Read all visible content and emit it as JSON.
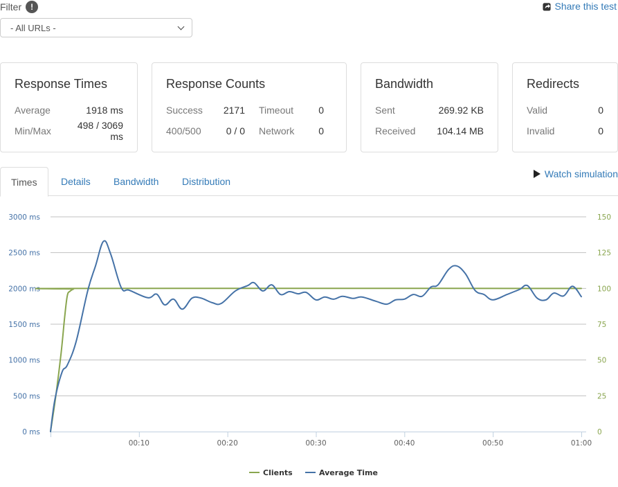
{
  "filter": {
    "label": "Filter",
    "info_icon": "exclamation-icon",
    "selected": "- All URLs -"
  },
  "share": {
    "label": "Share this test",
    "icon": "share-icon"
  },
  "cards": {
    "response_times": {
      "title": "Response Times",
      "average_label": "Average",
      "average_value": "1918 ms",
      "minmax_label": "Min/Max",
      "minmax_value": "498 / 3069 ms"
    },
    "response_counts": {
      "title": "Response Counts",
      "success_label": "Success",
      "success_value": "2171",
      "timeout_label": "Timeout",
      "timeout_value": "0",
      "errors_label": "400/500",
      "errors_value": "0 / 0",
      "network_label": "Network",
      "network_value": "0"
    },
    "bandwidth": {
      "title": "Bandwidth",
      "sent_label": "Sent",
      "sent_value": "269.92 KB",
      "received_label": "Received",
      "received_value": "104.14 MB"
    },
    "redirects": {
      "title": "Redirects",
      "valid_label": "Valid",
      "valid_value": "0",
      "invalid_label": "Invalid",
      "invalid_value": "0"
    }
  },
  "tabs": [
    {
      "label": "Times",
      "active": true
    },
    {
      "label": "Details",
      "active": false
    },
    {
      "label": "Bandwidth",
      "active": false
    },
    {
      "label": "Distribution",
      "active": false
    }
  ],
  "watch_simulation": {
    "label": "Watch simulation",
    "icon": "play-icon"
  },
  "colors": {
    "clients": "#89a54e",
    "average_time": "#4572a7",
    "link": "#337ab7"
  },
  "chart_data": {
    "type": "line",
    "title": "",
    "xlabel": "",
    "ylabel": "",
    "x_unit": "seconds",
    "x_ticks": [
      {
        "value": 10,
        "label": "00:10"
      },
      {
        "value": 20,
        "label": "00:20"
      },
      {
        "value": 30,
        "label": "00:30"
      },
      {
        "value": 40,
        "label": "00:40"
      },
      {
        "value": 50,
        "label": "00:50"
      },
      {
        "value": 60,
        "label": "01:00"
      }
    ],
    "xlim": [
      0,
      60
    ],
    "y_left": {
      "range": [
        0,
        3000
      ],
      "ticks": [
        {
          "value": 0,
          "label": "0 ms"
        },
        {
          "value": 500,
          "label": "500 ms"
        },
        {
          "value": 1000,
          "label": "1000 ms"
        },
        {
          "value": 1500,
          "label": "1500 ms"
        },
        {
          "value": 2000,
          "label": "2000 ms"
        },
        {
          "value": 2500,
          "label": "2500 ms"
        },
        {
          "value": 3000,
          "label": "3000 ms"
        }
      ]
    },
    "y_right": {
      "range": [
        0,
        150
      ],
      "ticks": [
        {
          "value": 0,
          "label": "0"
        },
        {
          "value": 25,
          "label": "25"
        },
        {
          "value": 50,
          "label": "50"
        },
        {
          "value": 75,
          "label": "75"
        },
        {
          "value": 100,
          "label": "100"
        },
        {
          "value": 125,
          "label": "125"
        },
        {
          "value": 150,
          "label": "150"
        }
      ]
    },
    "grid": true,
    "legend": "bottom-center",
    "series": [
      {
        "name": "Clients",
        "axis": "right",
        "color": "#89a54e",
        "x": [
          0,
          0.6,
          1.2,
          1.6,
          1.9,
          2.2,
          2.6,
          3,
          60
        ],
        "y": [
          0,
          25,
          55,
          80,
          95,
          98,
          99.5,
          100,
          100
        ]
      },
      {
        "name": "Average Time",
        "axis": "left",
        "color": "#4572a7",
        "x": [
          0,
          0.5,
          1.3,
          1.9,
          2.9,
          4.2,
          5.1,
          6,
          6.8,
          8,
          8.9,
          11,
          12,
          12.9,
          13.9,
          14.9,
          16,
          17,
          18.3,
          19.3,
          20.9,
          22.3,
          23,
          24,
          25,
          26,
          27,
          28,
          28.9,
          30,
          31,
          32,
          33,
          34.2,
          35.2,
          36.8,
          38,
          39,
          40,
          41,
          42,
          43,
          43.8,
          45,
          45.9,
          46.9,
          48,
          49,
          50,
          51.6,
          53,
          53.9,
          55,
          56,
          56.9,
          58,
          59,
          60
        ],
        "y": [
          0,
          450,
          830,
          930,
          1260,
          1965,
          2320,
          2660,
          2480,
          2010,
          1975,
          1870,
          1920,
          1770,
          1850,
          1710,
          1865,
          1865,
          1800,
          1790,
          1965,
          2040,
          2080,
          1965,
          2050,
          1915,
          1955,
          1925,
          1945,
          1840,
          1880,
          1850,
          1890,
          1860,
          1880,
          1820,
          1780,
          1840,
          1850,
          1915,
          1890,
          2020,
          2050,
          2265,
          2315,
          2205,
          1970,
          1915,
          1840,
          1915,
          1985,
          2040,
          1865,
          1840,
          1935,
          1895,
          2030,
          1885
        ]
      }
    ]
  }
}
